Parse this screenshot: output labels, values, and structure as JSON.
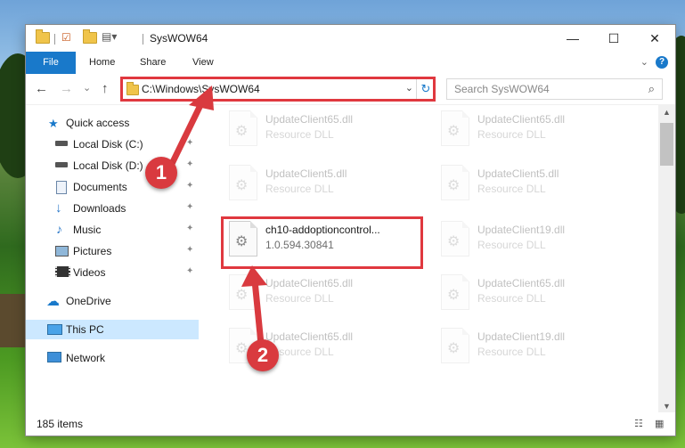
{
  "window": {
    "title": "SysWOW64",
    "minimize": "—",
    "maximize": "☐",
    "close": "✕"
  },
  "ribbon": {
    "tabs": [
      "File",
      "Home",
      "Share",
      "View"
    ],
    "help": "?"
  },
  "nav": {
    "back": "←",
    "forward": "→",
    "recent": "⌄",
    "up": "↑",
    "address": "C:\\Windows\\SysWOW64",
    "search_placeholder": "Search SysWOW64",
    "search_icon": "⌕",
    "refresh_icon": "↻",
    "dropdown_icon": "⌄"
  },
  "sidebar": {
    "items": [
      {
        "label": "Quick access",
        "icon": "star-icon"
      },
      {
        "label": "Local Disk (C:)",
        "icon": "drive-icon"
      },
      {
        "label": "Local Disk (D:)",
        "icon": "drive-icon"
      },
      {
        "label": "Documents",
        "icon": "documents-icon"
      },
      {
        "label": "Downloads",
        "icon": "download-icon"
      },
      {
        "label": "Music",
        "icon": "music-icon"
      },
      {
        "label": "Pictures",
        "icon": "pictures-icon"
      },
      {
        "label": "Videos",
        "icon": "videos-icon"
      },
      {
        "label": "OneDrive",
        "icon": "cloud-icon"
      },
      {
        "label": "This PC",
        "icon": "computer-icon"
      },
      {
        "label": "Network",
        "icon": "network-icon"
      }
    ],
    "pin": "📌"
  },
  "files": [
    {
      "name": "UpdateClient65.dll",
      "sub": "Resource DLL"
    },
    {
      "name": "UpdateClient65.dll",
      "sub": "Resource DLL"
    },
    {
      "name": "UpdateClient5.dll",
      "sub": "Resource DLL"
    },
    {
      "name": "UpdateClient5.dll",
      "sub": "Resource DLL"
    },
    {
      "name": "ch10-addoptioncontrol...",
      "sub": "1.0.594.30841"
    },
    {
      "name": "UpdateClient19.dll",
      "sub": "Resource DLL"
    },
    {
      "name": "UpdateClient65.dll",
      "sub": "Resource DLL"
    },
    {
      "name": "UpdateClient65.dll",
      "sub": "Resource DLL"
    },
    {
      "name": "UpdateClient65.dll",
      "sub": "Resource DLL"
    },
    {
      "name": "UpdateClient19.dll",
      "sub": "Resource DLL"
    }
  ],
  "status": {
    "count": "185 items"
  },
  "callouts": [
    "1",
    "2"
  ],
  "colors": {
    "accent": "#1979ca",
    "highlight": "#e0383f",
    "selection": "#cce8ff"
  }
}
